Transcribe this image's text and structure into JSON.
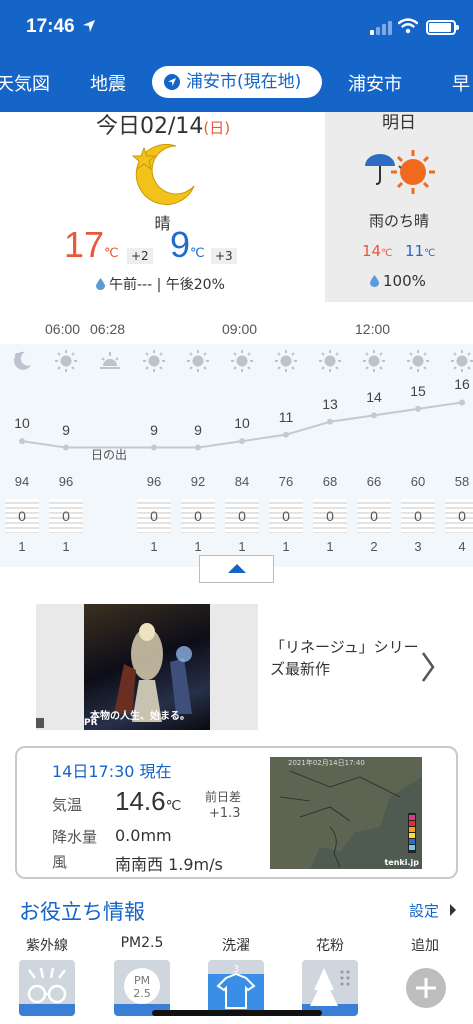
{
  "status_bar": {
    "time": "17:46"
  },
  "tabs": [
    "天気図",
    "地震",
    "浦安市(現在地)",
    "浦安市",
    "早"
  ],
  "today": {
    "date": "今日02/14",
    "dow": "(日)",
    "condition": "晴",
    "high": "17",
    "high_diff": "+2",
    "low": "9",
    "low_diff": "+3",
    "unit": "℃",
    "rain": "午前--- | 午後20%"
  },
  "tomorrow": {
    "title": "明日",
    "condition": "雨のち晴",
    "high": "14",
    "low": "11",
    "unit": "℃",
    "rain": "100%"
  },
  "hourly": {
    "time_labels": [
      "06:00",
      "06:28",
      "09:00",
      "12:00"
    ],
    "sunrise_label": "日の出",
    "temps": [
      "10",
      "9",
      "9",
      "9",
      "10",
      "11",
      "13",
      "14",
      "15",
      "16"
    ],
    "humidity": [
      "94",
      "96",
      "96",
      "92",
      "84",
      "76",
      "68",
      "66",
      "60",
      "58"
    ],
    "precip": [
      "0",
      "0",
      "0",
      "0",
      "0",
      "0",
      "0",
      "0",
      "0",
      "0"
    ],
    "wind": [
      "1",
      "1",
      "1",
      "1",
      "1",
      "1",
      "1",
      "2",
      "3",
      "4"
    ],
    "icons": [
      "moon-icon",
      "sun-icon",
      "sunrise-icon",
      "sun-icon",
      "sun-icon",
      "sun-icon",
      "sun-icon",
      "sun-icon",
      "sun-icon",
      "sun-icon",
      "sun-icon"
    ]
  },
  "ad": {
    "caption": "本物の人生、始まる。",
    "pr": "PR",
    "text": "「リネージュ」シリーズ最新作"
  },
  "current": {
    "title": "14日17:30 現在",
    "temp_label": "気温",
    "temp_value": "14.6",
    "temp_unit": "℃",
    "diff_label": "前日差",
    "diff_value": "+1.3",
    "precip_label": "降水量",
    "precip_value": "0.0mm",
    "wind_label": "風",
    "wind_value": "南南西 1.9m/s",
    "map_time": "2021年02月14日17:40",
    "map_brand": "tenki.jp"
  },
  "info": {
    "title": "お役立ち情報",
    "settings": "設定",
    "items": [
      "紫外線",
      "PM2.5",
      "洗濯",
      "花粉",
      "追加"
    ]
  },
  "colors": {
    "brand": "#1565c8",
    "warm": "#e8593b",
    "cool": "#1f6dc9"
  }
}
